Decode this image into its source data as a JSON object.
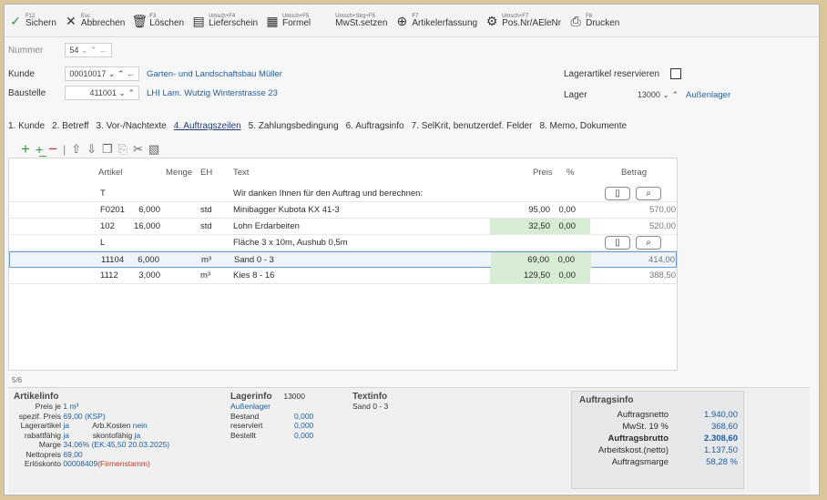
{
  "toolbar": [
    {
      "key": "F12",
      "label": "Sichern",
      "icon": "check-icon",
      "glyph": "✓",
      "color": "#2e9a3e"
    },
    {
      "key": "Esc",
      "label": "Abbrechen",
      "icon": "cross-icon",
      "glyph": "✕",
      "color": "#333333"
    },
    {
      "key": "F3",
      "label": "Löschen",
      "icon": "trash-icon",
      "glyph": "🗑",
      "color": "#333333"
    },
    {
      "key": "Umsch+F4",
      "label": "Lieferschein",
      "icon": "document-icon",
      "glyph": "▤",
      "color": "#333333"
    },
    {
      "key": "Umsch+F5",
      "label": "Formel",
      "icon": "formula-icon",
      "glyph": "▦",
      "color": "#333333"
    },
    {
      "key": "Umsch+Strg+F5",
      "label": "MwSt.setzen",
      "icon": "tax-icon",
      "glyph": "",
      "color": "#333333"
    },
    {
      "key": "F7",
      "label": "Artikelerfassung",
      "icon": "plus-circle-icon",
      "glyph": "⊕",
      "color": "#333333"
    },
    {
      "key": "Umsch+F7",
      "label": "Pos.Nr/AEleNr",
      "icon": "gear-icon",
      "glyph": "⚙",
      "color": "#333333"
    },
    {
      "key": "F8",
      "label": "Drucken",
      "icon": "printer-icon",
      "glyph": "⎙",
      "color": "#333333"
    }
  ],
  "header": {
    "nummer_label": "Nummer",
    "nummer_value": "54",
    "kunde_label": "Kunde",
    "kunde_value": "00010017",
    "kunde_name": "Garten- und Landschaftsbau Müller",
    "baustelle_label": "Baustelle",
    "baustelle_value": "411001",
    "baustelle_name": "LHI Lam. Wutzig Winterstrasse 23",
    "lagerartikel_label": "Lagerartikel reservieren",
    "lager_label": "Lager",
    "lager_value": "13000",
    "lager_name": "Außenlager"
  },
  "tabs": [
    {
      "label": "1. Kunde",
      "active": false
    },
    {
      "label": "2. Betreff",
      "active": false
    },
    {
      "label": "3. Vor-/Nachtexte",
      "active": false
    },
    {
      "label": "4. Auftragszeilen",
      "active": true
    },
    {
      "label": "5. Zahlungsbedingung",
      "active": false
    },
    {
      "label": "6. Auftragsinfo",
      "active": false
    },
    {
      "label": "7. SelKrit, benutzerdef. Felder",
      "active": false
    },
    {
      "label": "8. Memo, Dokumente",
      "active": false
    }
  ],
  "grid": {
    "headers": {
      "artikel": "Artikel",
      "menge": "Menge",
      "eh": "EH",
      "text": "Text",
      "preis": "Preis",
      "pct": "%",
      "betrag": "Betrag"
    },
    "rows": [
      {
        "artikel": "T",
        "menge": "",
        "eh": "",
        "text": "Wir danken Ihnen für den Auftrag und berechnen:",
        "preis": "",
        "pct": "",
        "betrag": "",
        "buttons": true,
        "green": false,
        "sel": false
      },
      {
        "artikel": "F0201",
        "menge": "6,000",
        "eh": "std",
        "text": "Minibagger Kubota KX 41-3",
        "preis": "95,00",
        "pct": "0,00",
        "betrag": "570,00",
        "buttons": false,
        "green": false,
        "sel": false
      },
      {
        "artikel": "102",
        "menge": "16,000",
        "eh": "std",
        "text": "Lohn Erdarbeiten",
        "preis": "32,50",
        "pct": "0,00",
        "betrag": "520,00",
        "buttons": false,
        "green": true,
        "sel": false
      },
      {
        "artikel": "L",
        "menge": "",
        "eh": "",
        "text": "Fläche 3 x 10m, Aushub 0,5m",
        "preis": "",
        "pct": "",
        "betrag": "",
        "buttons": true,
        "green": false,
        "sel": false
      },
      {
        "artikel": "11104",
        "menge": "6,000",
        "eh": "m³",
        "text": "Sand 0 - 3",
        "preis": "69,00",
        "pct": "0,00",
        "betrag": "414,00",
        "buttons": false,
        "green": true,
        "sel": true
      },
      {
        "artikel": "1112",
        "menge": "3,000",
        "eh": "m³",
        "text": "Kies 8 - 16",
        "preis": "129,50",
        "pct": "0,00",
        "betrag": "388,50",
        "buttons": false,
        "green": true,
        "sel": false
      }
    ]
  },
  "status_left": "5/6",
  "artikelinfo": {
    "title": "Artikelinfo",
    "preis_je_label": "Preis je",
    "preis_je_value": "1 m³",
    "spez_preis_label": "spezif. Preis",
    "spez_preis_value": "69,00 (KSP)",
    "lagerartikel_label": "Lagerartikel",
    "lagerartikel_value": "ja",
    "arbkosten_label": "Arb.Kosten",
    "arbkosten_value": "nein",
    "rabattfaehig_label": "rabattfähig",
    "rabattfaehig_value": "ja",
    "skontofaehig_label": "skontofähig",
    "skontofaehig_value": "ja",
    "marge_label": "Marge",
    "marge_value": "34,06% (EK:45,50 20.03.2025)",
    "nettopreis_label": "Nettopreis",
    "nettopreis_value": "69,00",
    "erloeskonto_label": "Erlöskonto",
    "erloeskonto_value": "00008409",
    "erloeskonto_note": "(Firmenstamm)"
  },
  "lagerinfo": {
    "title": "Lagerinfo",
    "lager_num": "13000",
    "lager_name": "Außenlager",
    "bestand_label": "Bestand",
    "bestand_value": "0,000",
    "reserviert_label": "reserviert",
    "reserviert_value": "0,000",
    "bestellt_label": "Bestellt",
    "bestellt_value": "0,000"
  },
  "textinfo": {
    "title": "Textinfo",
    "value": "Sand 0 - 3"
  },
  "auftragsinfo": {
    "title": "Auftragsinfo",
    "netto_label": "Auftragsnetto",
    "netto_value": "1.940,00",
    "mwst_label": "MwSt. 19 %",
    "mwst_value": "368,60",
    "brutto_label": "Auftragsbrutto",
    "brutto_value": "2.308,60",
    "arbkost_label": "Arbeitskost.(netto)",
    "arbkost_value": "1.137,50",
    "marge_label": "Auftragsmarge",
    "marge_value": "58,28 %"
  }
}
